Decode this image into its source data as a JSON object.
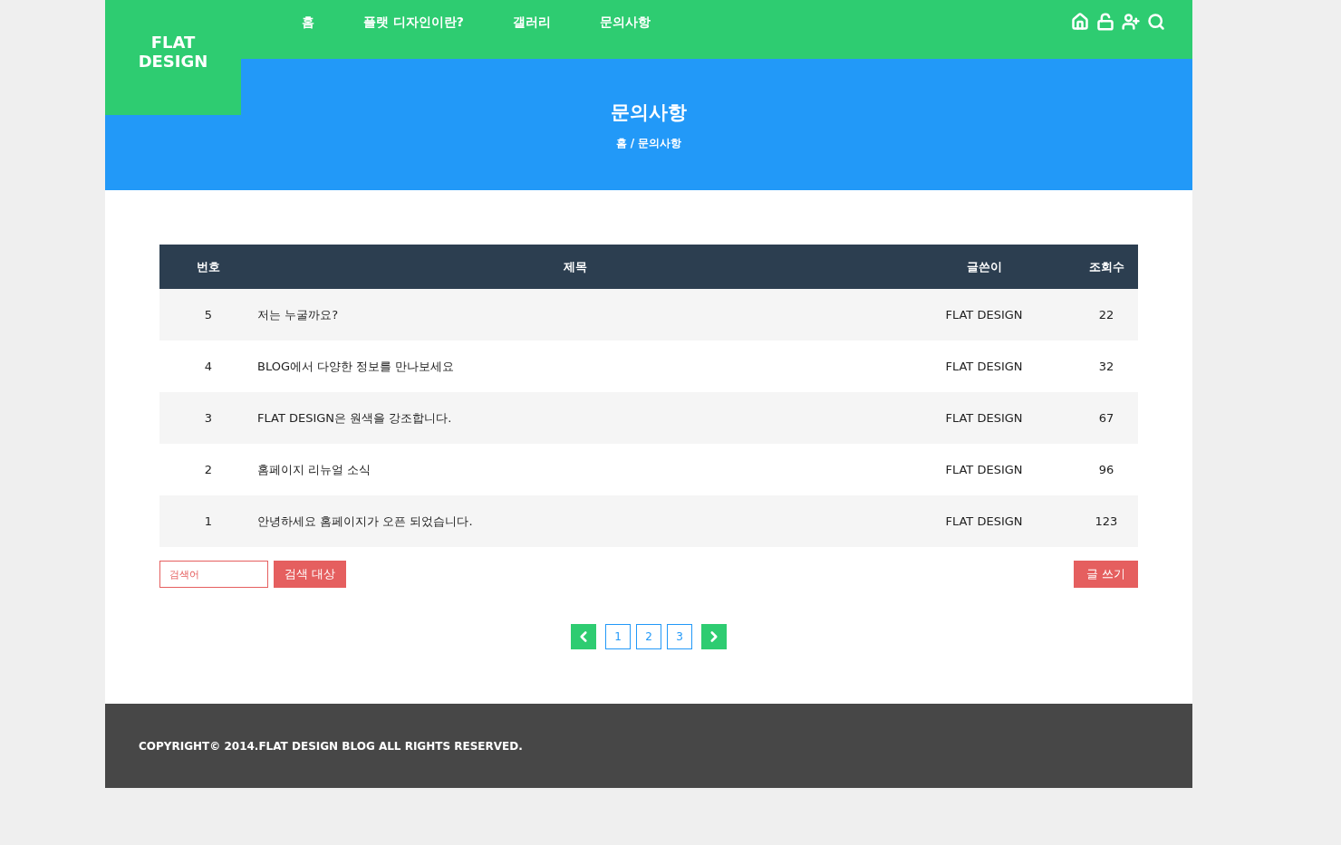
{
  "logo": "FLAT\nDESIGN",
  "nav": [
    {
      "label": "홈"
    },
    {
      "label": "플랫 디자인이란?"
    },
    {
      "label": "갤러리"
    },
    {
      "label": "문의사항"
    }
  ],
  "banner": {
    "title": "문의사항",
    "breadcrumb": "홈 / 문의사항"
  },
  "table": {
    "columns": [
      "번호",
      "제목",
      "글쓴이",
      "조회수"
    ],
    "rows": [
      {
        "number": "5",
        "title": "저는 누굴까요?",
        "author": "FLAT DESIGN",
        "views": "22"
      },
      {
        "number": "4",
        "title": "BLOG에서 다양한 정보를 만나보세요",
        "author": "FLAT DESIGN",
        "views": "32"
      },
      {
        "number": "3",
        "title": "FLAT DESIGN은 원색을 강조합니다.",
        "author": "FLAT DESIGN",
        "views": "67"
      },
      {
        "number": "2",
        "title": "홈페이지 리뉴얼 소식",
        "author": "FLAT DESIGN",
        "views": "96"
      },
      {
        "number": "1",
        "title": "안녕하세요 홈페이지가 오픈 되었습니다.",
        "author": "FLAT DESIGN",
        "views": "123"
      }
    ]
  },
  "search": {
    "placeholder": "검색어",
    "button": "검색 대상"
  },
  "write_button": "글 쓰기",
  "pagination": [
    {
      "label": "1",
      "selected": false
    },
    {
      "label": "2",
      "selected": false
    },
    {
      "label": "3",
      "selected": false
    }
  ],
  "footer": "COPYRIGHT© 2014.FLAT DESIGN BLOG ALL RIGHTS RESERVED."
}
